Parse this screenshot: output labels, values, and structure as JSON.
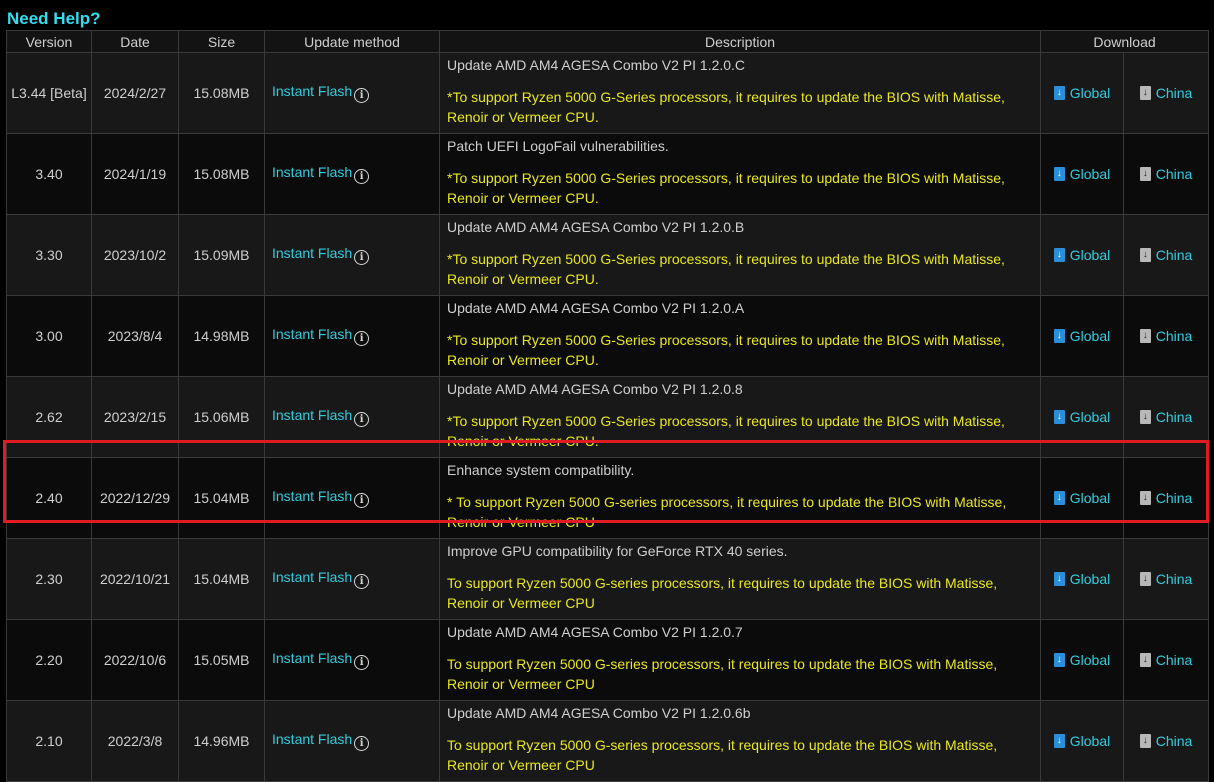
{
  "page": {
    "help_link": "Need Help?"
  },
  "table": {
    "headers": [
      "Version",
      "Date",
      "Size",
      "Update method",
      "Description",
      "Download"
    ],
    "rows": [
      {
        "version": "L3.44 [Beta]",
        "date": "2024/2/27",
        "size": "15.08MB",
        "method": "Instant Flash",
        "desc_title": "Update AMD AM4 AGESA Combo V2 PI 1.2.0.C",
        "desc_note": "*To support Ryzen 5000 G-Series processors, it requires to update the BIOS with Matisse, Renoir or Vermeer CPU.",
        "global": "Global",
        "china": "China"
      },
      {
        "version": "3.40",
        "date": "2024/1/19",
        "size": "15.08MB",
        "method": "Instant Flash",
        "desc_title": "Patch UEFI LogoFail vulnerabilities.",
        "desc_note": "*To support Ryzen 5000 G-Series processors, it requires to update the BIOS with Matisse, Renoir or Vermeer CPU.",
        "global": "Global",
        "china": "China"
      },
      {
        "version": "3.30",
        "date": "2023/10/2",
        "size": "15.09MB",
        "method": "Instant Flash",
        "desc_title": "Update AMD AM4 AGESA Combo V2 PI 1.2.0.B",
        "desc_note": "*To support Ryzen 5000 G-Series processors, it requires to update the BIOS with Matisse, Renoir or Vermeer CPU.",
        "global": "Global",
        "china": "China"
      },
      {
        "version": "3.00",
        "date": "2023/8/4",
        "size": "14.98MB",
        "method": "Instant Flash",
        "desc_title": "Update AMD AM4 AGESA Combo V2 PI 1.2.0.A",
        "desc_note": "*To support Ryzen 5000 G-Series processors, it requires to update the BIOS with Matisse, Renoir or Vermeer CPU.",
        "global": "Global",
        "china": "China"
      },
      {
        "version": "2.62",
        "date": "2023/2/15",
        "size": "15.06MB",
        "method": "Instant Flash",
        "desc_title": "Update AMD AM4 AGESA Combo V2 PI 1.2.0.8",
        "desc_note": "*To support Ryzen 5000 G-Series processors, it requires to update the BIOS with Matisse, Renoir or Vermeer CPU.",
        "global": "Global",
        "china": "China"
      },
      {
        "version": "2.40",
        "date": "2022/12/29",
        "size": "15.04MB",
        "method": "Instant Flash",
        "desc_title": "Enhance system compatibility.",
        "desc_note": "* To support Ryzen 5000 G-series processors, it requires to update the BIOS with Matisse, Renoir or Vermeer CPU",
        "global": "Global",
        "china": "China"
      },
      {
        "version": "2.30",
        "date": "2022/10/21",
        "size": "15.04MB",
        "method": "Instant Flash",
        "desc_title": "Improve GPU compatibility for GeForce RTX 40 series.",
        "desc_note": "To support Ryzen 5000 G-series processors, it requires to update the BIOS with Matisse, Renoir or Vermeer CPU",
        "global": "Global",
        "china": "China"
      },
      {
        "version": "2.20",
        "date": "2022/10/6",
        "size": "15.05MB",
        "method": "Instant Flash",
        "desc_title": "Update AMD AM4 AGESA Combo V2 PI 1.2.0.7",
        "desc_note": "To support Ryzen 5000 G-series processors, it requires to update the BIOS with Matisse, Renoir or Vermeer CPU",
        "global": "Global",
        "china": "China"
      },
      {
        "version": "2.10",
        "date": "2022/3/8",
        "size": "14.96MB",
        "method": "Instant Flash",
        "desc_title": "Update AMD AM4 AGESA Combo V2 PI 1.2.0.6b",
        "desc_note": "To support Ryzen 5000 G-series processors, it requires to update the BIOS with Matisse, Renoir or Vermeer CPU",
        "global": "Global",
        "china": "China"
      }
    ],
    "highlighted_row": 5
  },
  "icons": {
    "info": "info-circle-icon",
    "global_download": "download-file-blue-icon",
    "china_download": "download-file-gray-icon"
  },
  "colors": {
    "link": "#33ccdd",
    "note": "#e8e820",
    "highlight": "#e01b22",
    "heading": "#33ddee"
  }
}
